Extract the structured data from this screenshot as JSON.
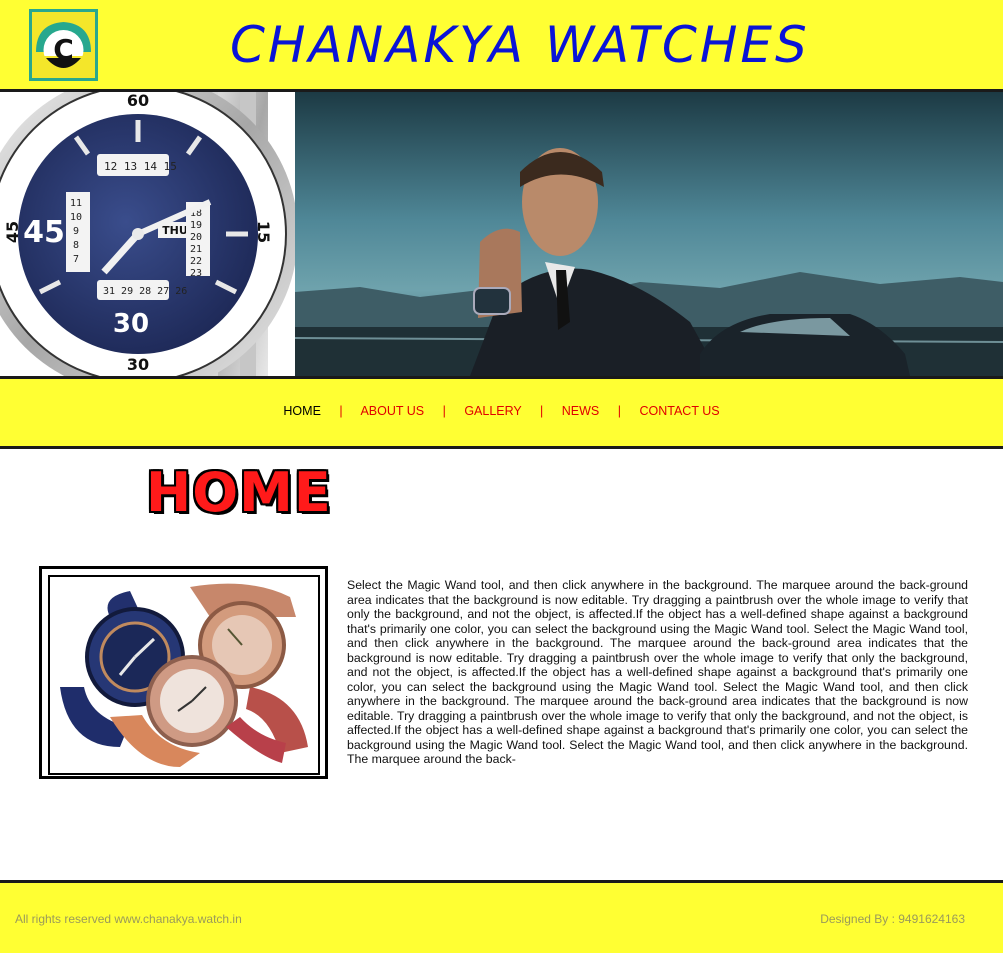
{
  "header": {
    "logo_letter": "C",
    "brand_title": "CHANAKYA WATCHES"
  },
  "banner": {
    "watch_dial_numbers": {
      "top": "60",
      "left": "45",
      "right": "15",
      "bottom": "30",
      "dial_left": "45",
      "dial_bottom": "30"
    },
    "day_window": "THU",
    "date_digits_top": [
      "12",
      "13",
      "14",
      "15"
    ],
    "date_digits_right": [
      "18",
      "19",
      "20",
      "21",
      "22",
      "23"
    ],
    "date_digits_bottom": [
      "31",
      "29",
      "28",
      "27",
      "26"
    ],
    "date_digits_left": [
      "11",
      "10",
      "9",
      "8",
      "7"
    ]
  },
  "nav": {
    "items": [
      {
        "label": "HOME",
        "active": true
      },
      {
        "label": "ABOUT US",
        "active": false
      },
      {
        "label": "GALLERY",
        "active": false
      },
      {
        "label": "NEWS",
        "active": false
      },
      {
        "label": "CONTACT US",
        "active": false
      }
    ],
    "separator": "|"
  },
  "main": {
    "page_title": "HOME",
    "body_text": "Select the Magic Wand tool, and then click anywhere in the background. The marquee around the back-ground area indicates that the background is now editable. Try dragging a paintbrush over the whole image to verify that only the background, and not the object, is affected.If the object has a well-defined shape against a background that's primarily one color, you can select the background using the Magic Wand tool. Select the Magic Wand tool, and then click anywhere in the background. The marquee around the back-ground area indicates that the background is now editable. Try dragging a paintbrush over the whole image to verify that only the background, and not the object, is affected.If the object has a well-defined shape against a background that's primarily one color, you can select the background using the Magic Wand tool. Select the Magic Wand tool, and then click anywhere in the background. The marquee around the back-ground area indicates that the background is now editable. Try dragging a paintbrush over the whole image to verify that only the background, and not the object, is affected.If the object has a well-defined shape against a background that's primarily one color, you can select the background using the Magic Wand tool. Select the Magic Wand tool, and then click anywhere in the background. The marquee around the back-"
  },
  "footer": {
    "rights": "All rights reserved www.chanakya.watch.in",
    "designed_by": "Designed By : 9491624163"
  },
  "colors": {
    "header_bg": "#ffff33",
    "brand_blue": "#0a14d6",
    "nav_red": "#e00000",
    "rule_dark": "#1a1a1a"
  }
}
